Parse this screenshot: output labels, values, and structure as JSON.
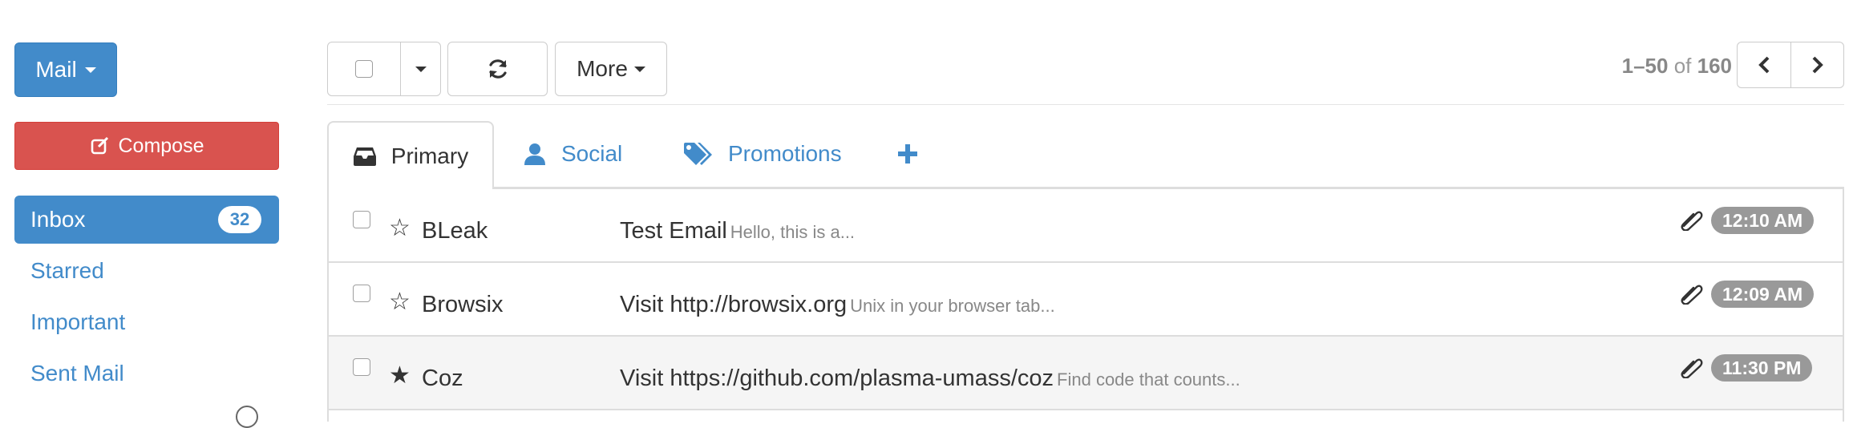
{
  "toolbar": {
    "mail_label": "Mail",
    "more_label": "More",
    "pagination": {
      "range": "1–50",
      "of": "of",
      "total": "160"
    }
  },
  "sidebar": {
    "compose_label": "Compose",
    "items": [
      {
        "label": "Inbox",
        "badge": "32",
        "active": true
      },
      {
        "label": "Starred"
      },
      {
        "label": "Important"
      },
      {
        "label": "Sent Mail"
      }
    ]
  },
  "tabs": [
    {
      "label": "Primary",
      "icon": "inbox-icon",
      "active": true
    },
    {
      "label": "Social",
      "icon": "user-icon"
    },
    {
      "label": "Promotions",
      "icon": "tags-icon"
    },
    {
      "label": "+",
      "icon": "plus-icon"
    }
  ],
  "emails": [
    {
      "sender": "BLeak",
      "subject": "Test Email",
      "preview": "Hello, this is a...",
      "time": "12:10 AM",
      "starred": false,
      "attachment": true
    },
    {
      "sender": "Browsix",
      "subject": "Visit http://browsix.org",
      "preview": "Unix in your browser tab...",
      "time": "12:09 AM",
      "starred": false,
      "attachment": true
    },
    {
      "sender": "Coz",
      "subject": "Visit https://github.com/plasma-umass/coz",
      "preview": "Find code that counts...",
      "time": "11:30 PM",
      "starred": true,
      "attachment": true
    }
  ],
  "colors": {
    "primary": "#428bca",
    "danger": "#d9534f",
    "badge_gray": "#999999"
  }
}
